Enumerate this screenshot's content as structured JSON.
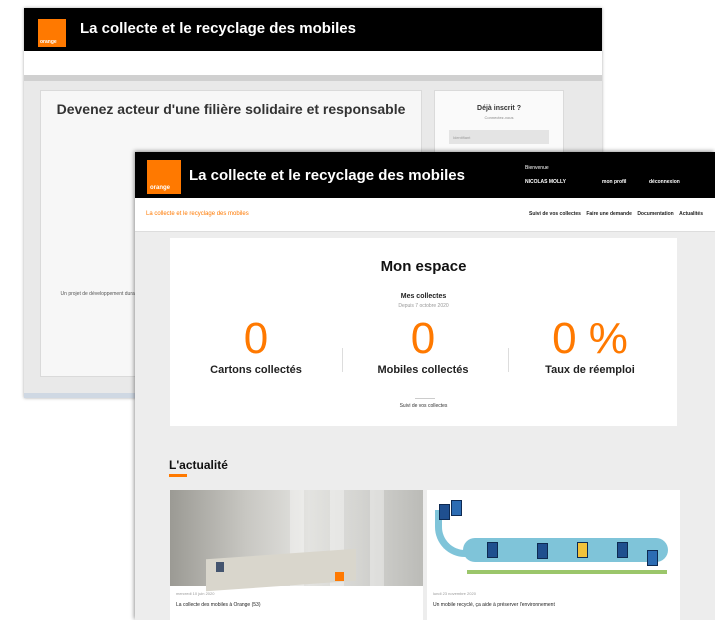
{
  "back": {
    "logo_text": "orange",
    "brand": "La collecte et le recyclage des mobiles",
    "panel_title": "Devenez acteur d'une filière solidaire et responsable",
    "panel_note": "Un projet de développement durable",
    "login_title": "Déjà inscrit ?",
    "login_sub": "Connectez-vous",
    "login_field": "Identifiant"
  },
  "front": {
    "logo_text": "orange",
    "brand": "La collecte et le recyclage des mobiles",
    "user": {
      "greeting": "Bienvenue",
      "name": "NICOLAS MOLLY",
      "profile": "mon profil",
      "logout": "déconnexion"
    },
    "nav": {
      "home": "La collecte et le recyclage des mobiles",
      "links": [
        "Suivi de vos collectes",
        "Faire une demande",
        "Documentation",
        "Actualités"
      ]
    },
    "espace": {
      "title": "Mon espace",
      "subtitle": "Mes collectes",
      "date": "Depuis 7 octobre 2020",
      "stats": [
        {
          "value": "0",
          "label": "Cartons collectés"
        },
        {
          "value": "0",
          "label": "Mobiles collectés"
        },
        {
          "value": "0 %",
          "label": "Taux de réemploi"
        }
      ],
      "link": "Suivi de vos collectes"
    },
    "news": {
      "title": "L'actualité",
      "items": [
        {
          "date": "mercredi 10 juin 2020",
          "caption": "La collecte des mobiles à Orange (53)"
        },
        {
          "date": "lundi 23 novembre 2020",
          "caption": "Un mobile recyclé, ça aide à préserver l'environnement"
        }
      ]
    }
  },
  "colors": {
    "accent": "#ff7900",
    "header": "#000000"
  }
}
